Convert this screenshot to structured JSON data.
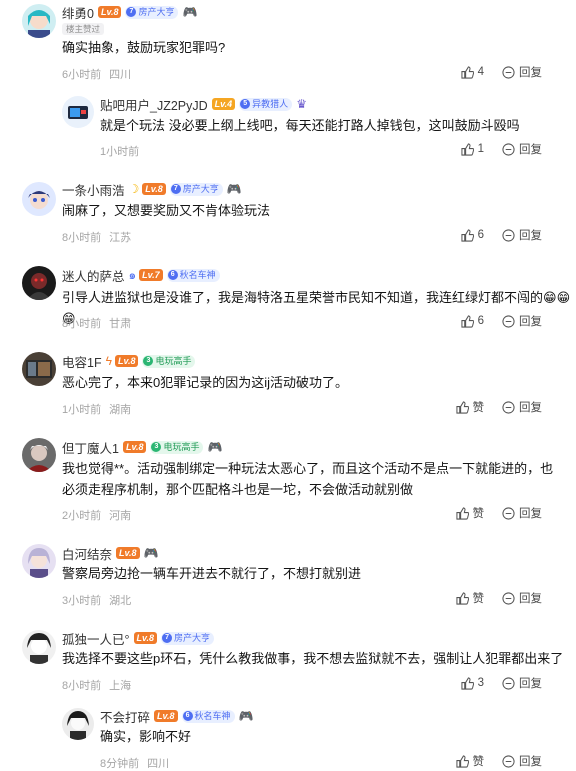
{
  "comments": [
    {
      "name": "绯勇0",
      "level": "Lv.8",
      "tag": "房产大亨",
      "tag_icon": "7",
      "has_game_badge": true,
      "op_badge": "楼主赞过",
      "text": "确实抽象，鼓励玩家犯罪吗?",
      "time": "6小时前",
      "location": "四川",
      "likes": "4",
      "reply_label": "回复"
    },
    {
      "name": "贴吧用户_JZ2PyJD",
      "level": "Lv.4",
      "tag": "异教猎人",
      "tag_icon": "5",
      "text": "就是个玩法 没必要上纲上线吧，每天还能打路人掉钱包，这叫鼓励斗殴吗",
      "time": "1小时前",
      "location": "",
      "likes": "1",
      "reply_label": "回复"
    },
    {
      "name": "一条小雨浩",
      "level": "Lv.8",
      "tag": "房产大亨",
      "tag_icon": "7",
      "text": "闹麻了，又想要奖励又不肯体验玩法",
      "time": "8小时前",
      "location": "江苏",
      "likes": "6",
      "reply_label": "回复"
    },
    {
      "name": "迷人的萨总",
      "level": "Lv.7",
      "tag": "秋名车神",
      "tag_icon": "6",
      "text": "引导人进监狱也是没谁了，我是海特洛五星荣誉市民知不知道，我连红绿灯都不闯的",
      "emojis": "😁😁😁",
      "time": "8小时前",
      "location": "甘肃",
      "likes": "6",
      "reply_label": "回复"
    },
    {
      "name": "电容1F",
      "level": "Lv.8",
      "tag": "电玩高手",
      "tag_icon": "3",
      "text": "恶心完了，本来0犯罪记录的因为这ij活动破功了。",
      "time": "1小时前",
      "location": "湖南",
      "likes": "赞",
      "reply_label": "回复"
    },
    {
      "name": "但丁魔人1",
      "level": "Lv.8",
      "tag": "电玩高手",
      "tag_icon": "3",
      "has_game_badge": true,
      "text": "我也觉得**。活动强制绑定一种玩法太恶心了，而且这个活动不是点一下就能进的，也必须走程序机制，那个匹配格斗也是一坨，不会做活动就别做",
      "time": "2小时前",
      "location": "河南",
      "likes": "赞",
      "reply_label": "回复"
    },
    {
      "name": "白河结奈",
      "level": "Lv.8",
      "has_game_badge": true,
      "text": "警察局旁边抢一辆车开进去不就行了，不想打就别进",
      "time": "3小时前",
      "location": "湖北",
      "likes": "赞",
      "reply_label": "回复"
    },
    {
      "name": "孤独一人已°",
      "level": "Lv.8",
      "tag": "房产大亨",
      "tag_icon": "7",
      "text": "我选择不要这些p环石，凭什么教我做事，我不想去监狱就不去，强制让人犯罪都出来了",
      "time": "8小时前",
      "location": "上海",
      "likes": "3",
      "reply_label": "回复"
    },
    {
      "name": "不会打碎",
      "level": "Lv.8",
      "tag": "秋名车神",
      "tag_icon": "6",
      "has_game_badge": true,
      "text": "确实，影响不好",
      "time": "8分钟前",
      "location": "四川",
      "likes": "赞",
      "reply_label": "回复"
    }
  ],
  "colors": {
    "accent": "#4e6ef2",
    "level": "#f07b2a",
    "meta": "#a5a5a5"
  }
}
